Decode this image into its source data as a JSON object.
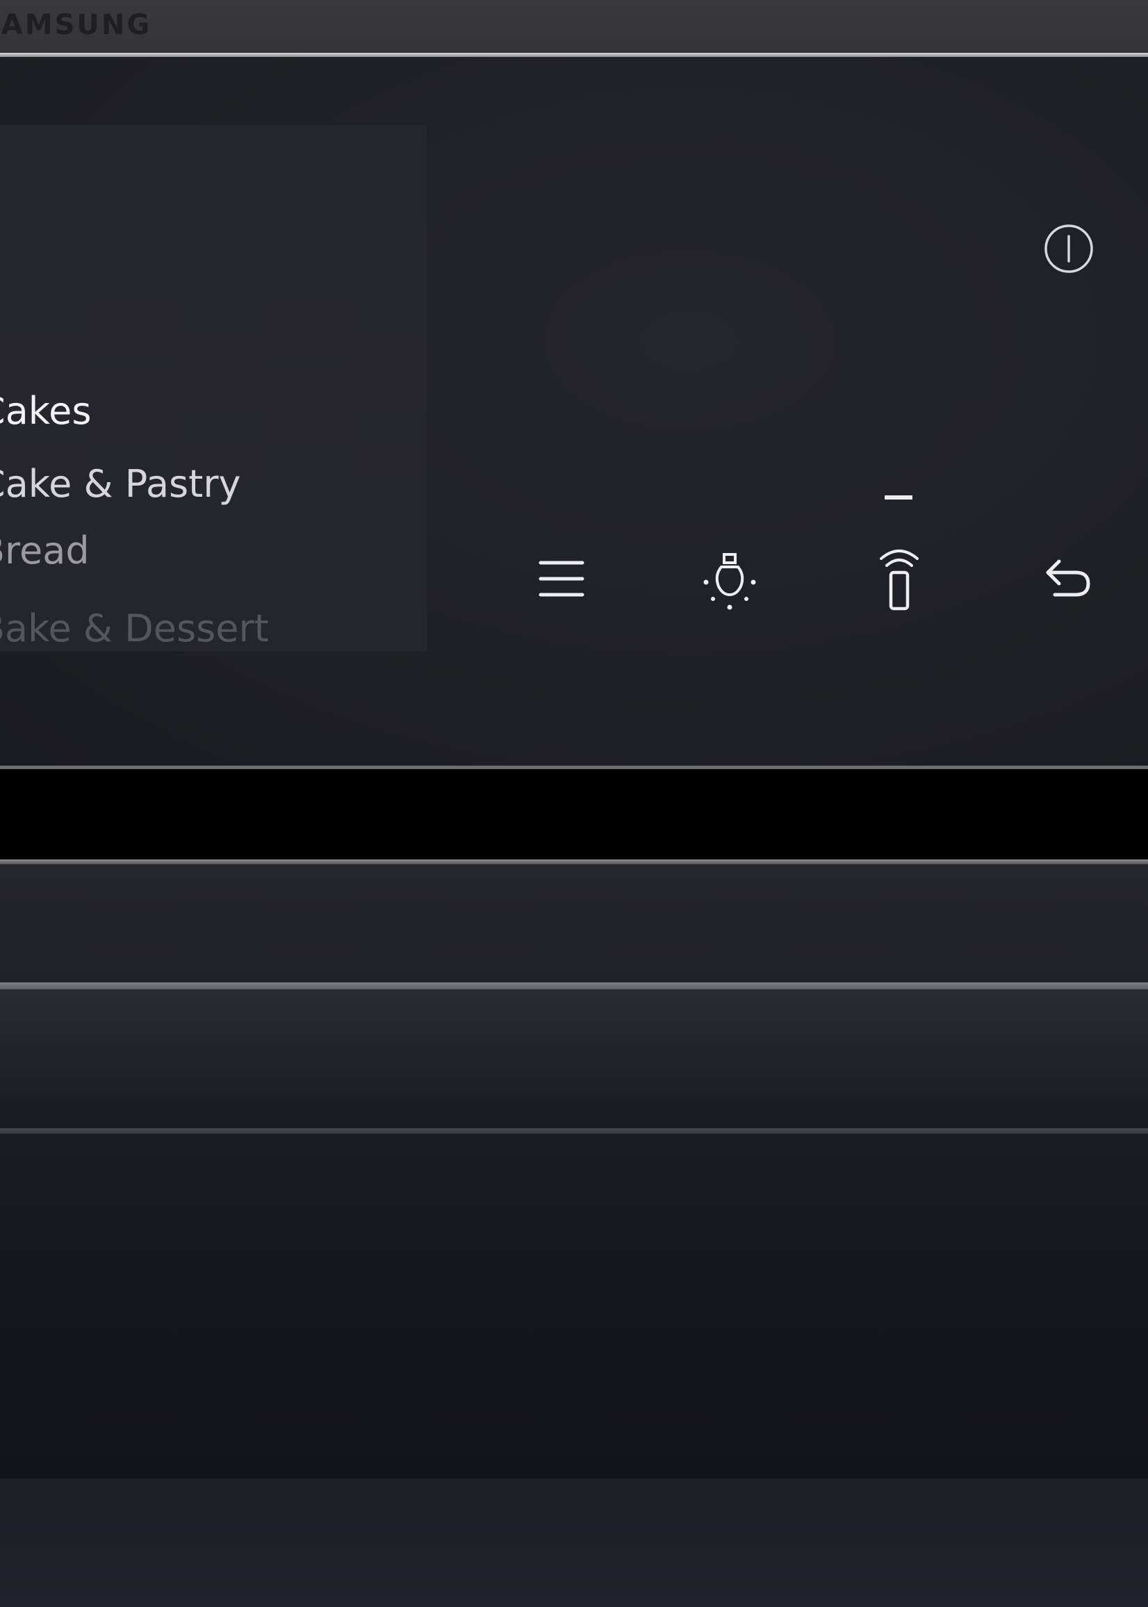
{
  "brand": {
    "name": "SAMSUNG"
  },
  "menu": {
    "items": [
      {
        "label": "Cakes"
      },
      {
        "label": "Cake & Pastry"
      },
      {
        "label": "Bread"
      },
      {
        "label": "Bake & Dessert"
      }
    ]
  },
  "controls": {
    "power": {
      "icon": "power-icon"
    },
    "menu": {
      "icon": "menu-icon"
    },
    "light": {
      "icon": "light-bulb-icon"
    },
    "remote": {
      "icon": "remote-control-icon",
      "indicator": "—"
    },
    "back": {
      "icon": "back-arrow-icon"
    }
  },
  "colors": {
    "panel": "#1f2025",
    "icon": "#eeeef0",
    "menu_active": "#f2f2f4",
    "menu_inactive": "#9a9aa0"
  }
}
